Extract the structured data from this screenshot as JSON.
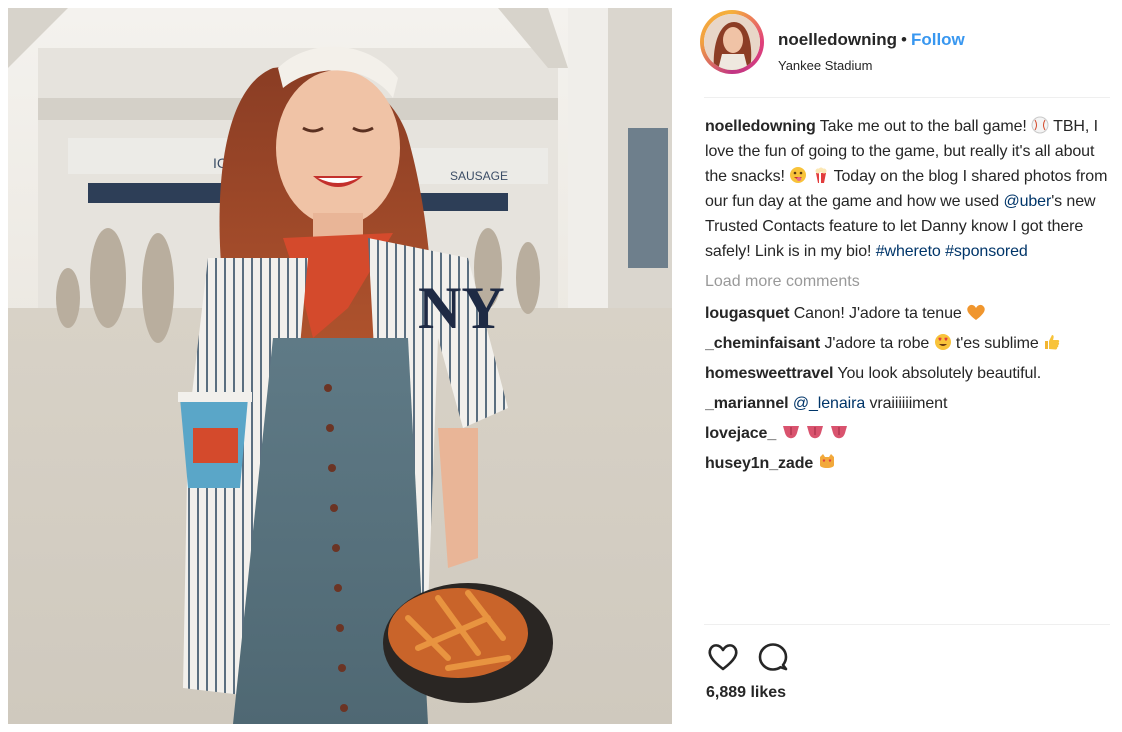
{
  "post": {
    "username": "noelledowning",
    "separator": "•",
    "follow_label": "Follow",
    "location": "Yankee Stadium",
    "photo_signage": {
      "ice": "ICE",
      "sausage": "SAUSAGE"
    },
    "caption": {
      "user": "noelledowning",
      "text_1": "Take me out to the ball game! ",
      "text_2": " TBH, I love the fun of going to the game, but really it's all about the snacks! ",
      "text_3": " Today on the blog I shared photos from our fun day at the game and how we used ",
      "mention": "@uber",
      "text_4": "'s new Trusted Contacts feature to let Danny know I got there safely! Link is in my bio! ",
      "hashtag_1": "#whereto",
      "hashtag_2": "#sponsored"
    },
    "load_more": "Load more comments",
    "comments": [
      {
        "user": "lougasquet",
        "text": "Canon! J'adore ta tenue"
      },
      {
        "user": "_cheminfaisant",
        "text": "J'adore ta robe",
        "text_2": "t'es sublime"
      },
      {
        "user": "homesweettravel",
        "text": "You look absolutely beautiful."
      },
      {
        "user": "_mariannel",
        "mention": "@_lenaira",
        "text": "vraiiiiiiment"
      },
      {
        "user": "lovejace_",
        "text": ""
      },
      {
        "user": "husey1n_zade",
        "text": ""
      },
      {
        "user": "",
        "text": ""
      }
    ],
    "likes": "6,889 likes",
    "time": ""
  },
  "icons": {
    "heart": "heart-icon",
    "comment": "comment-icon"
  },
  "colors": {
    "link": "#003569",
    "follow": "#3897f0",
    "muted": "#999999"
  }
}
